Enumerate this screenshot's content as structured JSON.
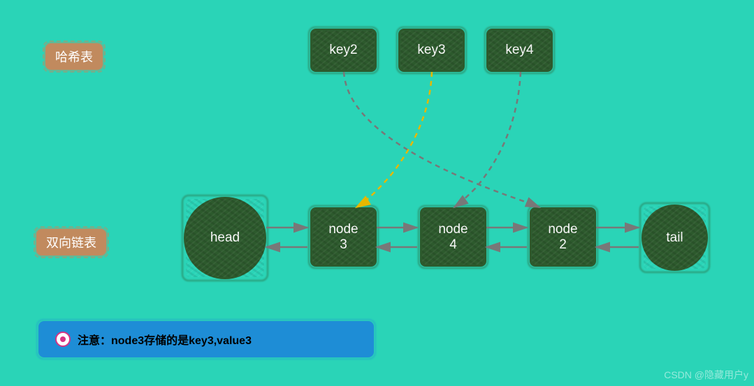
{
  "labels": {
    "hash_table": "哈希表",
    "linked_list": "双向链表"
  },
  "keys": {
    "key2": "key2",
    "key3": "key3",
    "key4": "key4"
  },
  "nodes": {
    "head": "head",
    "node3_line1": "node",
    "node3_line2": "3",
    "node4_line1": "node",
    "node4_line2": "4",
    "node2_line1": "node",
    "node2_line2": "2",
    "tail": "tail"
  },
  "note": {
    "text": "注意：node3存储的是key3,value3"
  },
  "watermark": "CSDN @隐藏用户y",
  "colors": {
    "bg": "#2ad4b7",
    "green": "#2d5a2d",
    "label": "#c18a5e",
    "note": "#1e8dd6",
    "arrow": "#787878",
    "highlight": "#e6b800"
  }
}
